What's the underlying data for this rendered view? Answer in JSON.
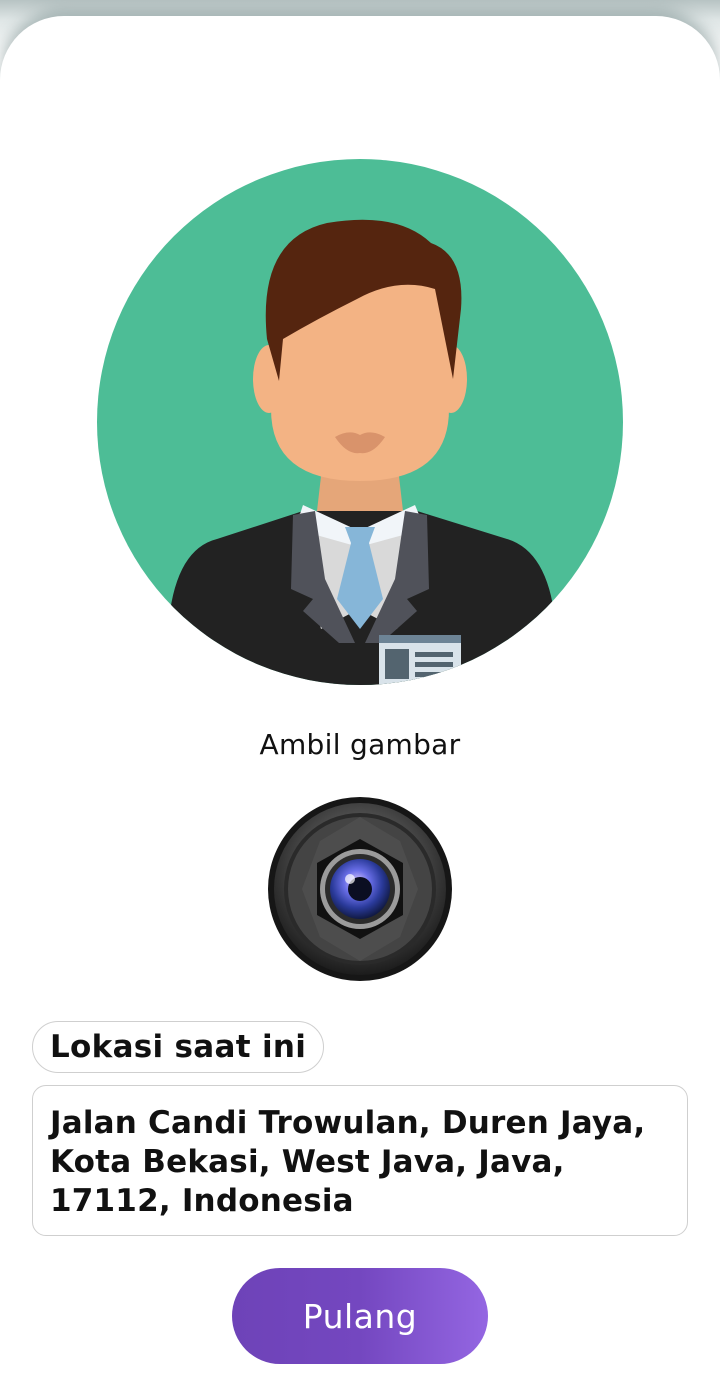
{
  "avatar": {
    "icon": "employee-avatar",
    "background_color": "#4dbd96",
    "hair_color": "#55250f",
    "skin_color": "#f3b384",
    "suit_color": "#222222",
    "tie_color": "#86b6d8"
  },
  "capture": {
    "label": "Ambil gambar",
    "icon": "camera-lens-icon"
  },
  "location": {
    "label": "Lokasi saat ini",
    "address": "Jalan Candi Trowulan, Duren Jaya, Kota Bekasi, West Java, Java, 17112, Indonesia"
  },
  "submit": {
    "label": "Pulang",
    "color": "#7447c0"
  }
}
